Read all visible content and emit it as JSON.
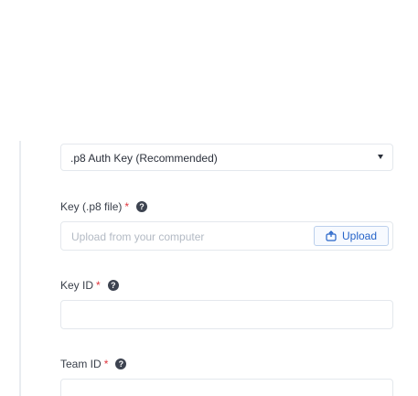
{
  "auth_type_select": {
    "value": ".p8 Auth Key (Recommended)"
  },
  "key_file_field": {
    "label": "Key (.p8 file)",
    "required_marker": "*",
    "help_icon": "question-icon",
    "placeholder": "Upload from your computer",
    "upload_label": "Upload",
    "upload_icon": "upload-icon"
  },
  "key_id_field": {
    "label": "Key ID",
    "required_marker": "*",
    "help_icon": "question-icon",
    "value": ""
  },
  "team_id_field": {
    "label": "Team ID",
    "required_marker": "*",
    "help_icon": "question-icon",
    "value": ""
  },
  "colors": {
    "required": "#e0343c",
    "upload_accent": "#2563c8",
    "border": "#e4e8ed"
  }
}
